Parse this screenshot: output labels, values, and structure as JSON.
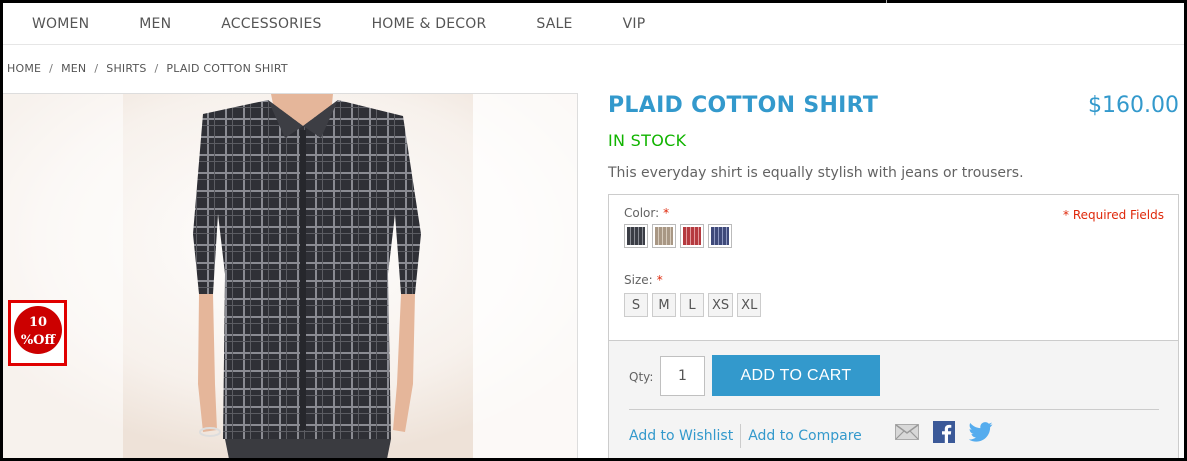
{
  "nav": {
    "items": [
      "WOMEN",
      "MEN",
      "ACCESSORIES",
      "HOME & DECOR",
      "SALE",
      "VIP"
    ]
  },
  "breadcrumb": [
    "HOME",
    "MEN",
    "SHIRTS",
    "PLAID COTTON SHIRT"
  ],
  "breadcrumb_separator": "/",
  "badge": {
    "line1": "10",
    "line2": "%Off",
    "color": "#cc0000"
  },
  "product": {
    "title": "PLAID COTTON SHIRT",
    "price": "$160.00",
    "stock": "IN STOCK",
    "description": "This everyday shirt is equally stylish with jeans or trousers."
  },
  "options": {
    "color_label": "Color:",
    "size_label": "Size:",
    "required_star": "*",
    "required_fields": "* Required Fields",
    "colors": [
      {
        "name": "charcoal plaid",
        "hex": "#3a3d45"
      },
      {
        "name": "khaki plaid",
        "hex": "#a89784"
      },
      {
        "name": "red plaid",
        "hex": "#b53a3f"
      },
      {
        "name": "blue plaid",
        "hex": "#3f4a7a"
      }
    ],
    "sizes": [
      "S",
      "M",
      "L",
      "XS",
      "XL"
    ]
  },
  "cart": {
    "qty_label": "Qty:",
    "qty_value": "1",
    "add_to_cart": "ADD TO CART",
    "wishlist": "Add to Wishlist",
    "compare": "Add to Compare"
  },
  "colors": {
    "accent": "#3399cc",
    "in_stock": "#11b400",
    "required": "#df280a"
  },
  "icons": [
    "email-icon",
    "facebook-icon",
    "twitter-icon"
  ]
}
